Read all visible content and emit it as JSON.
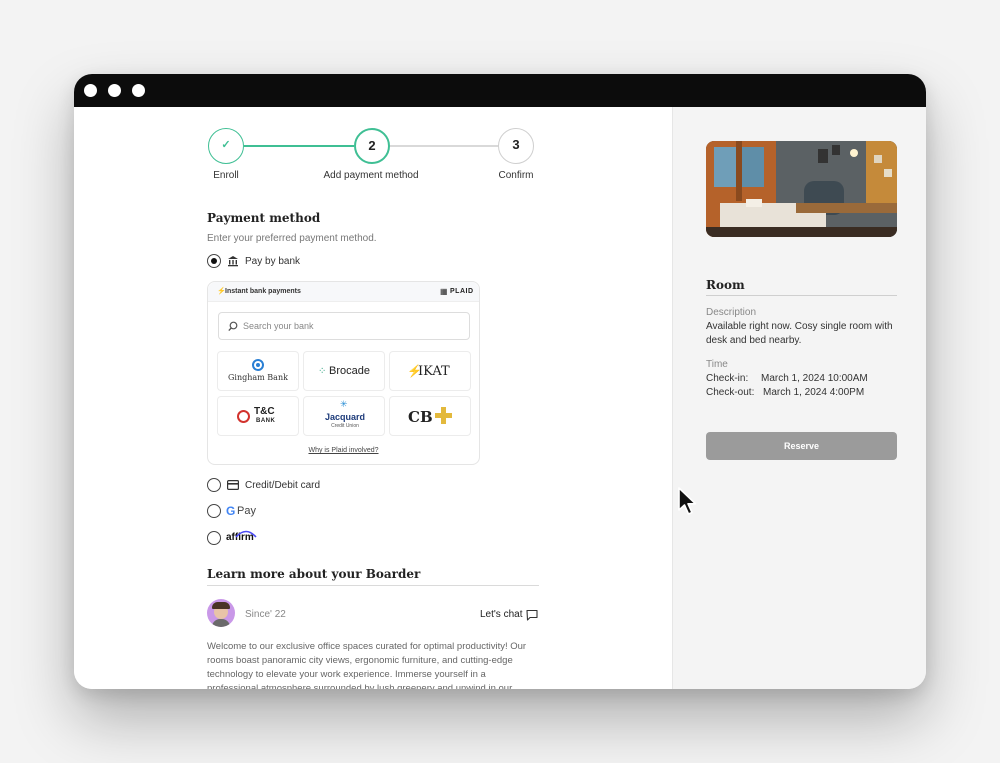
{
  "stepper": {
    "steps": [
      {
        "label": "Enroll",
        "state": "done",
        "number": "1"
      },
      {
        "label": "Add payment method",
        "state": "active",
        "number": "2"
      },
      {
        "label": "Confirm",
        "state": "pending",
        "number": "3"
      }
    ],
    "accent": "#3fbf94"
  },
  "payment": {
    "title": "Payment method",
    "subtitle": "Enter your preferred payment method.",
    "options": [
      {
        "label": "Pay by bank",
        "selected": true,
        "icon": "bank-icon"
      },
      {
        "label": "Credit/Debit card",
        "selected": false,
        "icon": "card-icon"
      },
      {
        "label": "Pay",
        "selected": false,
        "icon": "google-g-icon"
      },
      {
        "label": "affirm",
        "selected": false,
        "icon": "affirm-logo"
      }
    ]
  },
  "plaid": {
    "header": "Instant bank payments",
    "brand": "PLAID",
    "search_placeholder": "Search your bank",
    "banks": [
      {
        "name": "Gingham Bank"
      },
      {
        "name": "Brocade"
      },
      {
        "name": "IKAT"
      },
      {
        "name": "T&C",
        "sub": "BANK"
      },
      {
        "name": "Jacquard",
        "sub": "Credit Union"
      },
      {
        "name": "CB"
      }
    ],
    "why_link": "Why is Plaid involved?"
  },
  "boarder": {
    "title": "Learn more about your Boarder",
    "since": "Since' 22",
    "chat": "Let's chat",
    "bio": "Welcome to our exclusive office spaces curated for optimal productivity! Our rooms boast panoramic city views, ergonomic furniture, and cutting-edge technology to elevate your work experience. Immerse yourself in a professional atmosphere surrounded by lush greenery and unwind in our"
  },
  "room": {
    "title": "Room",
    "description_label": "Description",
    "description": "Available right now. Cosy single room with desk and bed nearby.",
    "time_label": "Time",
    "checkin_label": "Check-in:",
    "checkin": "March 1, 2024 10:00AM",
    "checkout_label": "Check-out:",
    "checkout": "March 1, 2024 4:00PM",
    "reserve": "Reserve"
  }
}
